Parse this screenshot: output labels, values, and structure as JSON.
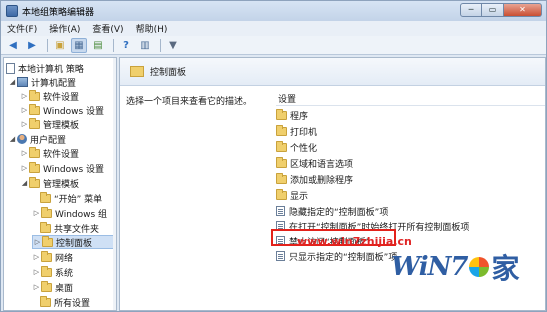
{
  "window": {
    "title": "本地组策略编辑器"
  },
  "menu": [
    "文件(F)",
    "操作(A)",
    "查看(V)",
    "帮助(H)"
  ],
  "tree": {
    "root": "本地计算机 策略",
    "computer_config": "计算机配置",
    "computer_children": [
      "软件设置",
      "Windows 设置",
      "管理模板"
    ],
    "user_config": "用户配置",
    "user_children": [
      "软件设置",
      "Windows 设置",
      "管理模板"
    ],
    "admin_children": [
      "“开始” 菜单",
      "Windows 组",
      "共享文件夹",
      "控制面板",
      "网络",
      "系统",
      "桌面",
      "所有设置"
    ]
  },
  "right": {
    "header": "控制面板",
    "description": "选择一个项目来查看它的描述。",
    "column": "设置",
    "folders": [
      "程序",
      "打印机",
      "个性化",
      "区域和语言选项",
      "添加或删除程序",
      "显示"
    ],
    "settings": [
      "隐藏指定的“控制面板”项",
      "在打开“控制面板”时始终打开所有控制面板项",
      "禁止访问“控制面板”",
      "只显示指定的“控制面板”项"
    ]
  },
  "watermark": {
    "url": "www.win7zhijia.cn",
    "logo_text": "WiN7",
    "logo_char": "家"
  },
  "colors": {
    "highlight": "#e3221b",
    "accent": "#2f5ea3"
  }
}
